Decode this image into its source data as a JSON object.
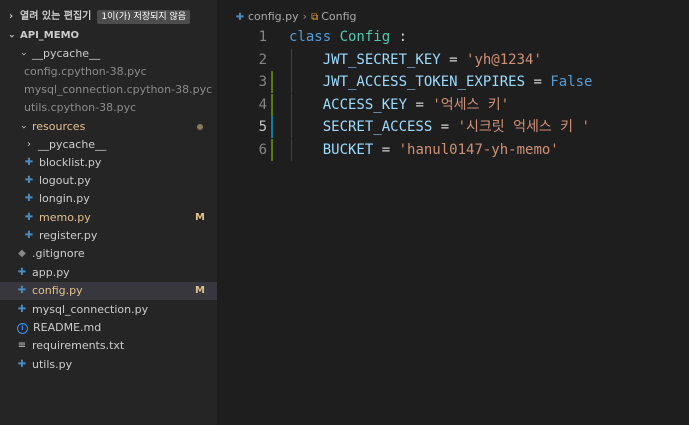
{
  "sidebar": {
    "open_editors": {
      "label": "열려 있는 편집기",
      "unsaved_badge": "1이(가) 저장되지 않음"
    },
    "project": {
      "name": "API_MEMO"
    },
    "items": [
      {
        "label": "__pycache__",
        "kind": "folder",
        "state": "open"
      },
      {
        "label": "config.cpython-38.pyc",
        "kind": "pyc"
      },
      {
        "label": "mysql_connection.cpython-38.pyc",
        "kind": "pyc"
      },
      {
        "label": "utils.cpython-38.pyc",
        "kind": "pyc"
      },
      {
        "label": "resources",
        "kind": "folder",
        "state": "open"
      },
      {
        "label": "__pycache__",
        "kind": "folder",
        "state": "closed"
      },
      {
        "label": "blocklist.py",
        "kind": "py"
      },
      {
        "label": "logout.py",
        "kind": "py"
      },
      {
        "label": "longin.py",
        "kind": "py"
      },
      {
        "label": "memo.py",
        "kind": "py",
        "badge": "M"
      },
      {
        "label": "register.py",
        "kind": "py"
      },
      {
        "label": ".gitignore",
        "kind": "git"
      },
      {
        "label": "app.py",
        "kind": "py"
      },
      {
        "label": "config.py",
        "kind": "py",
        "badge": "M",
        "selected": true
      },
      {
        "label": "mysql_connection.py",
        "kind": "py"
      },
      {
        "label": "README.md",
        "kind": "info"
      },
      {
        "label": "requirements.txt",
        "kind": "text"
      },
      {
        "label": "utils.py",
        "kind": "py"
      }
    ]
  },
  "editor": {
    "breadcrumb": {
      "file": "config.py",
      "symbol": "Config"
    },
    "lines": [
      {
        "num": "1",
        "tokens": [
          [
            "kw",
            "class "
          ],
          [
            "cls",
            "Config"
          ],
          [
            "op",
            " :"
          ]
        ]
      },
      {
        "num": "2",
        "tokens": [
          [
            "var",
            "    JWT_SECRET_KEY"
          ],
          [
            "op",
            " = "
          ],
          [
            "str",
            "'yh@1234'"
          ]
        ]
      },
      {
        "num": "3",
        "tokens": [
          [
            "var",
            "    JWT_ACCESS_TOKEN_EXPIRES"
          ],
          [
            "op",
            " = "
          ],
          [
            "bool",
            "False"
          ]
        ]
      },
      {
        "num": "4",
        "tokens": [
          [
            "var",
            "    ACCESS_KEY"
          ],
          [
            "op",
            " = "
          ],
          [
            "str",
            "'억세스 키'"
          ]
        ]
      },
      {
        "num": "5",
        "tokens": [
          [
            "var",
            "    SECRET_ACCESS"
          ],
          [
            "op",
            " = "
          ],
          [
            "str",
            "'시크릿 억세스 키 '"
          ]
        ]
      },
      {
        "num": "6",
        "tokens": [
          [
            "var",
            "    BUCKET"
          ],
          [
            "op",
            " = "
          ],
          [
            "str",
            "'hanul0147-yh-memo'"
          ]
        ]
      }
    ]
  },
  "colors": {
    "gutter_added": "#587c0c",
    "gutter_modified": "#0c7d9d",
    "accent": "#e2c08d"
  }
}
